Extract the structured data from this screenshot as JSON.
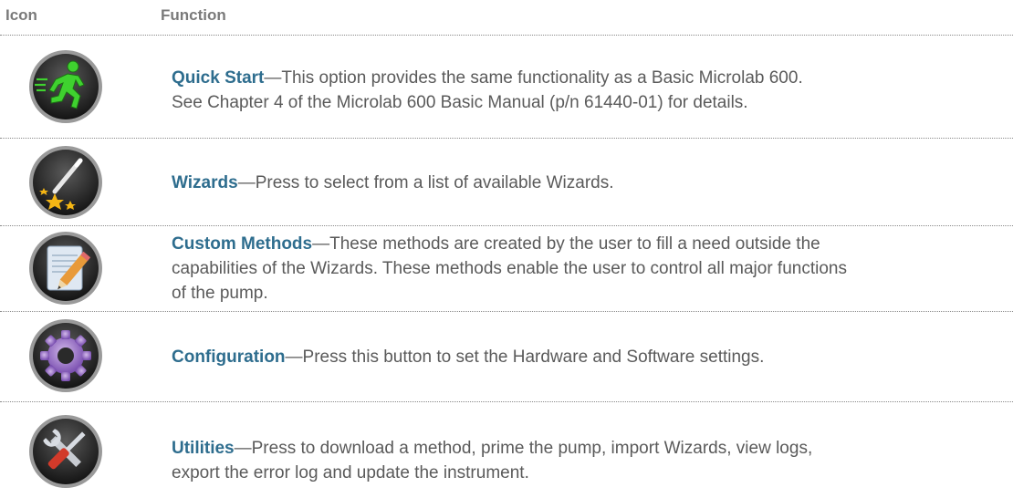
{
  "header": {
    "icon_col": "Icon",
    "function_col": "Function"
  },
  "rows": [
    {
      "icon": "quick-start-runner-icon",
      "title": "Quick Start",
      "dash": "—",
      "line1": "This option provides the same functionality as a Basic Microlab 600.",
      "line2": "See Chapter 4 of the Microlab 600 Basic Manual (p/n 61440-01) for details.",
      "line3": ""
    },
    {
      "icon": "wizard-wand-icon",
      "title": "Wizards",
      "dash": "—",
      "line1": "Press to select from a list of available Wizards.",
      "line2": "",
      "line3": ""
    },
    {
      "icon": "custom-methods-pencil-icon",
      "title": "Custom Methods",
      "dash": "—",
      "line1": "These methods are created by the user to fill a need outside the",
      "line2": "capabilities of the Wizards. These methods enable the user to control all major functions",
      "line3": "of the pump."
    },
    {
      "icon": "configuration-gear-icon",
      "title": "Configuration",
      "dash": "—",
      "line1": "Press this button to set the Hardware and Software settings.",
      "line2": "",
      "line3": ""
    },
    {
      "icon": "utilities-tools-icon",
      "title": "Utilities",
      "dash": "—",
      "line1": "Press to download a method, prime the pump, import Wizards, view logs,",
      "line2": "export the error log and update the instrument.",
      "line3": ""
    }
  ],
  "colors": {
    "title_blue": "#2e6d8e",
    "body_text": "#5a5a5a",
    "header_text": "#7a7a7a"
  }
}
